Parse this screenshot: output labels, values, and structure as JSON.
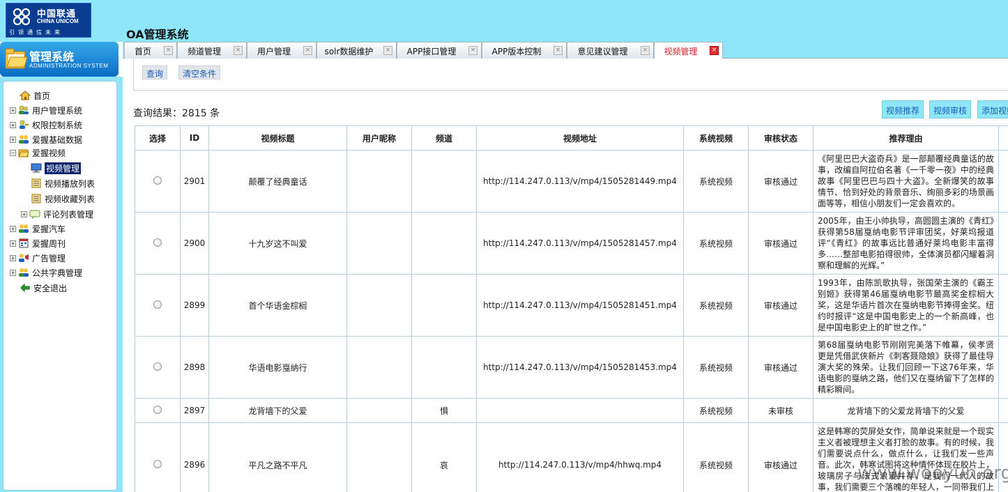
{
  "brand": {
    "logo_cn": "中国联通",
    "logo_en": "CHINA UNICOM",
    "logo_slogan": "引领通信未来"
  },
  "app": {
    "title": "OA管理系统"
  },
  "sidebar": {
    "title_cn": "管理系统",
    "title_en": "ADMINISTRATION SYSTEM",
    "items": [
      {
        "label": "首页",
        "icon": "home-icon"
      },
      {
        "label": "用户管理系统",
        "icon": "users-icon",
        "expander": "+"
      },
      {
        "label": "权限控制系统",
        "icon": "user-key-icon",
        "expander": "+"
      },
      {
        "label": "爱握基础数据",
        "icon": "user-group-icon",
        "expander": "+"
      },
      {
        "label": "爱握视频",
        "icon": "folder-open-icon",
        "expander": "-"
      },
      {
        "label": "视频管理",
        "icon": "monitor-icon",
        "selected": true
      },
      {
        "label": "视频播放列表",
        "icon": "list-icon"
      },
      {
        "label": "视频收藏列表",
        "icon": "list-icon"
      },
      {
        "label": "评论列表管理",
        "icon": "comment-icon",
        "expander": "+"
      },
      {
        "label": "爱握汽车",
        "icon": "user-group-icon",
        "expander": "+"
      },
      {
        "label": "爱握周刊",
        "icon": "calendar-icon",
        "expander": "+"
      },
      {
        "label": "广告管理",
        "icon": "ads-icon",
        "expander": "+"
      },
      {
        "label": "公共字典管理",
        "icon": "user-group-icon",
        "expander": "+"
      },
      {
        "label": "安全退出",
        "icon": "exit-icon"
      }
    ]
  },
  "tabs": [
    {
      "label": "首页"
    },
    {
      "label": "频道管理"
    },
    {
      "label": "用户管理"
    },
    {
      "label": "solr数据维护"
    },
    {
      "label": "APP接口管理"
    },
    {
      "label": "APP版本控制"
    },
    {
      "label": "意见建议管理"
    },
    {
      "label": "视频管理",
      "active": true
    }
  ],
  "filter": {
    "query_button": "查询",
    "clear_button": "清空条件"
  },
  "result": {
    "count_text": "查询结果：2815 条"
  },
  "actions": {
    "recommend": "视频推荐",
    "review": "视频审核",
    "add": "添加视频"
  },
  "table": {
    "headers": [
      "选择",
      "ID",
      "视频标题",
      "用户昵称",
      "频道",
      "视频地址",
      "系统视频",
      "审核状态",
      "推荐理由"
    ],
    "rows": [
      {
        "id": "2901",
        "title": "颠覆了经典童话",
        "nickname": "",
        "channel": "",
        "url": "http://114.247.0.113/v/mp4/1505281449.mp4",
        "system": "系统视频",
        "status": "审核通过",
        "reason": "《阿里巴巴大盗奇兵》是一部颠覆经典童话的故事，改编自阿拉伯名著《一千零一夜》中的经典故事《阿里巴巴与四十大盗》。全新爆笑的故事情节、恰到好处的背景音乐、绚丽多彩的场景画面等等，相信小朋友们一定会喜欢的。"
      },
      {
        "id": "2900",
        "title": "十九岁这不叫爱",
        "nickname": "",
        "channel": "",
        "url": "http://114.247.0.113/v/mp4/1505281457.mp4",
        "system": "系统视频",
        "status": "审核通过",
        "reason": "2005年，由王小帅执导，高圆圆主演的《青红》获得第58届戛纳电影节评审团奖，好莱坞报道评“《青红》的故事远比普通好莱坞电影丰富得多……整部电影拍得很帅，全体演员都闪耀着洞察和理解的光辉。”"
      },
      {
        "id": "2899",
        "title": "首个华语金棕榈",
        "nickname": "",
        "channel": "",
        "url": "http://114.247.0.113/v/mp4/1505281451.mp4",
        "system": "系统视频",
        "status": "审核通过",
        "reason": "1993年，由陈凯歌执导，张国荣主演的《霸王别姬》获得第46届戛纳电影节最高奖金棕榈大奖，这是华语片首次在戛纳电影节捧得金奖。纽约时报评“这是中国电影史上的一个新高峰，也是中国电影史上的旷世之作。”"
      },
      {
        "id": "2898",
        "title": "华语电影戛纳行",
        "nickname": "",
        "channel": "",
        "url": "http://114.247.0.113/v/mp4/1505281453.mp4",
        "system": "系统视频",
        "status": "审核通过",
        "reason": "第68届戛纳电影节刚刚完美落下帷幕，侯孝贤更是凭借武侠新片《刺客聂隐娘》获得了最佳导演大奖的殊荣。让我们回顾一下这76年来，华语电影的戛纳之路，他们又在戛纳留下了怎样的精彩瞬间。"
      },
      {
        "id": "2897",
        "title": "龙背墙下的父爱",
        "nickname": "",
        "channel": "惧",
        "url": "",
        "system": "系统视频",
        "status": "未审核",
        "reason": "龙背墙下的父爱龙背墙下的父爱"
      },
      {
        "id": "2896",
        "title": "平凡之路不平凡",
        "nickname": "",
        "channel": "哀",
        "url": "http://114.247.0.113/v/mp4/hhwq.mp4",
        "system": "系统视频",
        "status": "审核通过",
        "reason": "这是韩寒的荧屏处女作，简单说来就是一个现实主义者被理想主义者打脸的故事。有的时候，我们需要说点什么，做点什么，让我们发一些声音。此次，韩寒试图将这种情怀体现在胶片上，玻璃房子与法式浪漫并存，是我们一代人的故事，我们需要三个落魄的年轻人，一同带我们上路。"
      }
    ]
  },
  "watermark": "www.wooyun.org"
}
